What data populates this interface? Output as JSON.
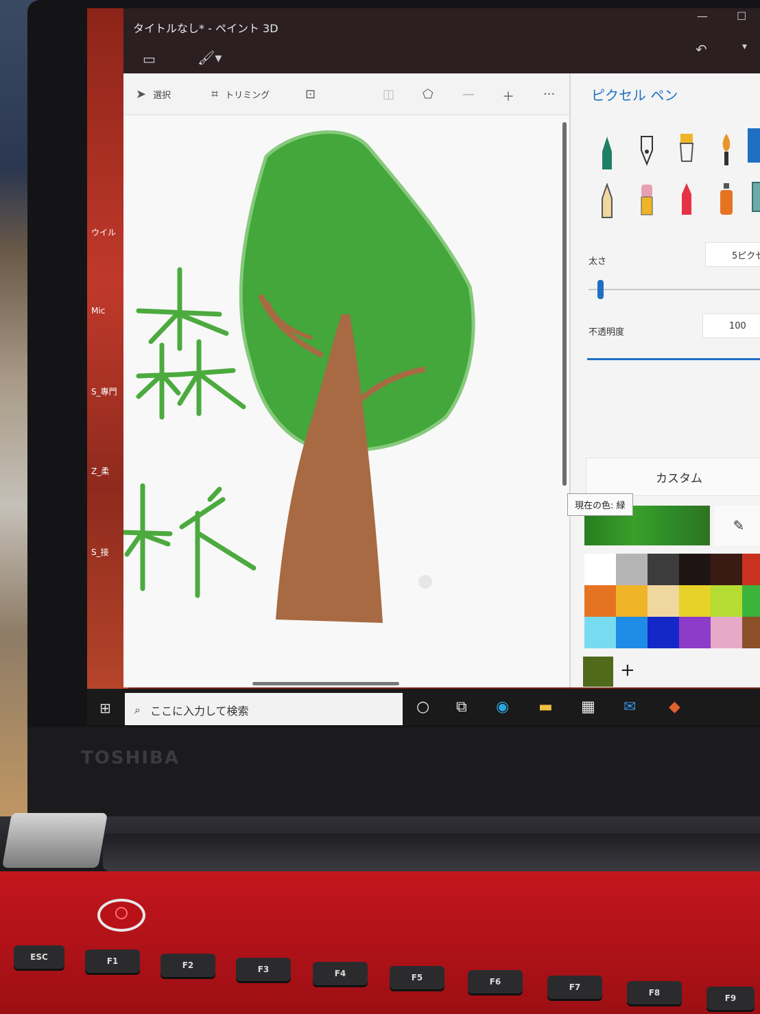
{
  "app": {
    "title": "タイトルなし* - ペイント 3D",
    "window_controls": {
      "minimize": "—",
      "maximize": "☐"
    }
  },
  "toolbar": {
    "select_label": "選択",
    "crop_label": "トリミング"
  },
  "canvas": {
    "text_top": "森",
    "text_bottom": "林"
  },
  "panel": {
    "title": "ピクセル ペン",
    "thickness_label": "太さ",
    "thickness_value": "5ピクセ",
    "thickness_level": 0.05,
    "opacity_label": "不透明度",
    "opacity_value": "100",
    "opacity_level": 1.0,
    "color_mode": "カスタム",
    "tooltip": "現在の色: 緑",
    "add_color": "+",
    "palette": [
      [
        "#ffffff",
        "#b4b4b4",
        "#3c3c3c",
        "#1e1414",
        "#3c1a14",
        "#c8321e"
      ],
      [
        "#e67322",
        "#f0b428",
        "#f0d7a0",
        "#e6d228",
        "#b4dc32",
        "#3cb43c"
      ],
      [
        "#78dcf0",
        "#1e8ce6",
        "#1428c8",
        "#8c3cc8",
        "#e6aac8",
        "#8c5028"
      ]
    ],
    "custom_color": "#4f6a1a"
  },
  "desktop_icons": [
    "ウイル",
    "Mic",
    "S_專門",
    "Z_柔",
    "S_接"
  ],
  "taskbar": {
    "search_placeholder": "ここに入力して検索"
  },
  "laptop": {
    "brand": "TOSHIBA",
    "keys": [
      "ESC",
      "F1",
      "F2",
      "F3",
      "F4",
      "F5",
      "F6",
      "F7",
      "F8",
      "F9"
    ]
  }
}
